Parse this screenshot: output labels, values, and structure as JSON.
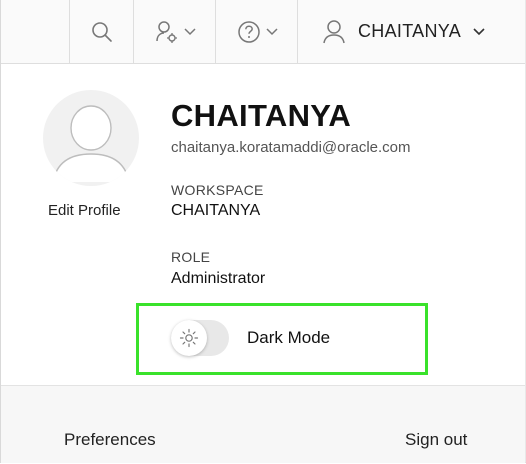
{
  "header": {
    "user_menu_label": "CHAITANYA"
  },
  "profile": {
    "display_name": "CHAITANYA",
    "email": "chaitanya.koratamaddi@oracle.com",
    "edit_profile_label": "Edit Profile",
    "workspace_label": "WORKSPACE",
    "workspace_value": "CHAITANYA",
    "role_label": "ROLE",
    "role_value": "Administrator"
  },
  "dark_mode": {
    "label": "Dark Mode",
    "enabled": false
  },
  "footer": {
    "preferences_label": "Preferences",
    "sign_out_label": "Sign out"
  },
  "colors": {
    "highlight": "#39e22a",
    "icon": "#777777"
  }
}
